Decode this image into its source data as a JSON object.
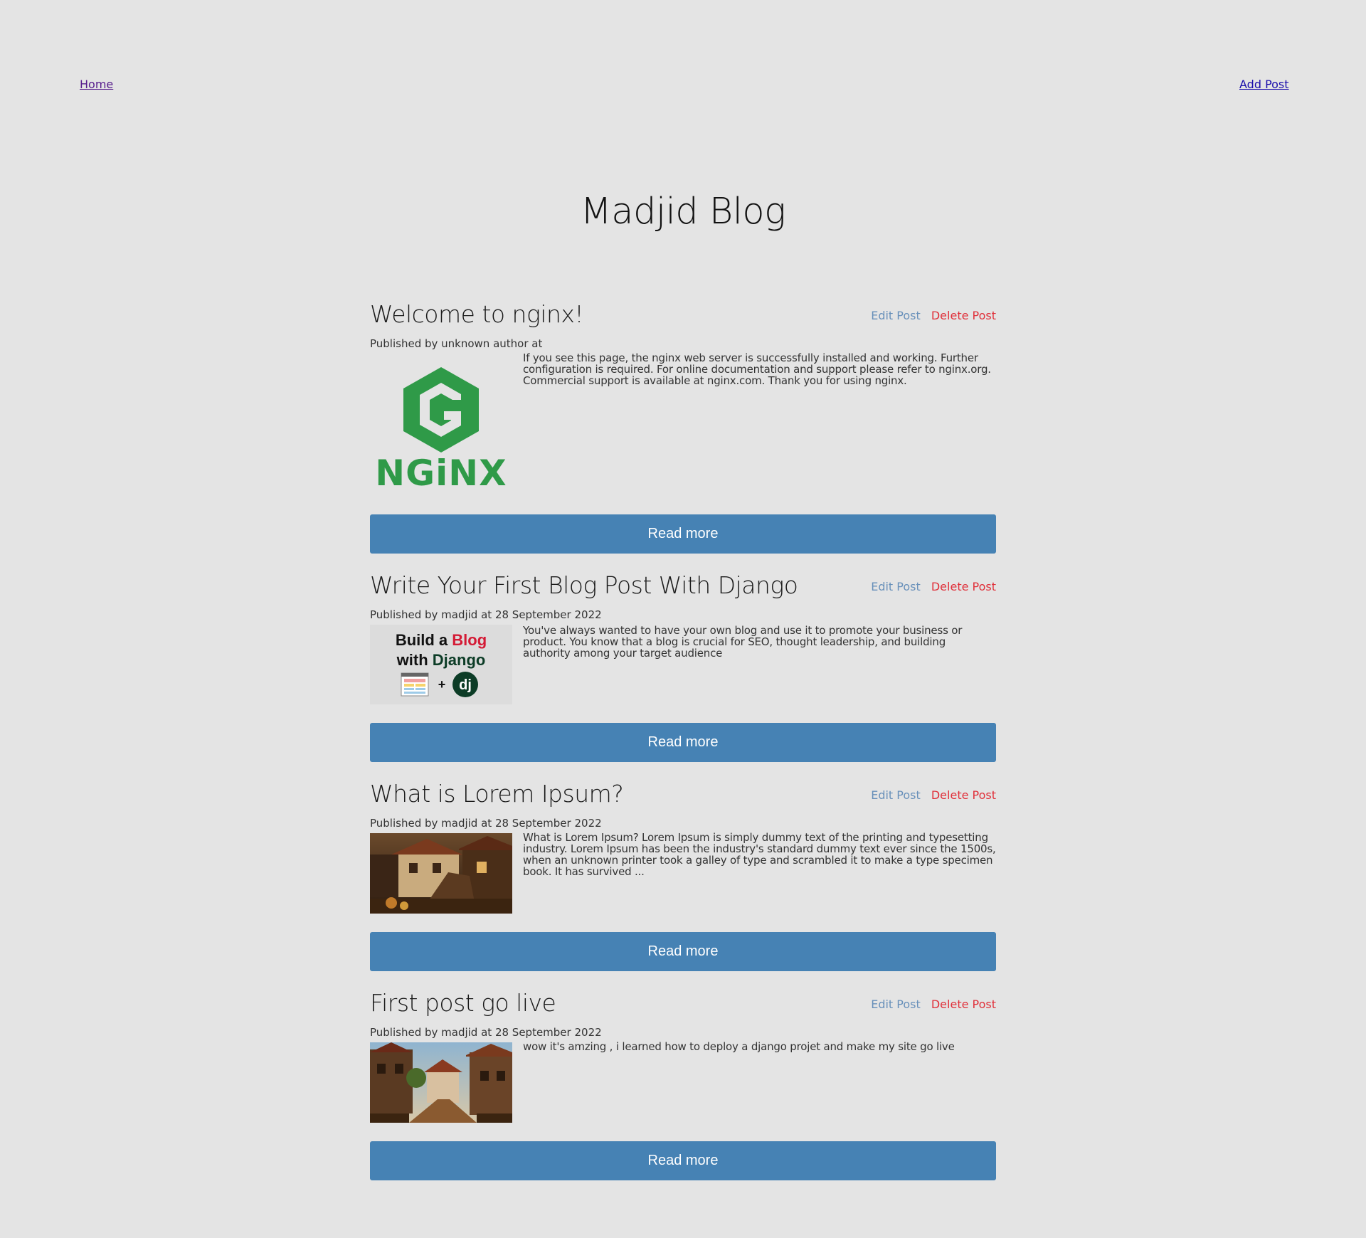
{
  "nav": {
    "home": "Home",
    "add_post": "Add Post"
  },
  "site_title": "Madjid Blog",
  "labels": {
    "edit": "Edit Post",
    "delete": "Delete Post",
    "read_more": "Read more"
  },
  "colors": {
    "background": "#e4e4e4",
    "button": "#4682b4",
    "edit_link": "#4a7cb0",
    "delete_link": "#e0303a",
    "nginx_green": "#2f9a48"
  },
  "posts": [
    {
      "title": "Welcome to nginx!",
      "meta": "Published by unknown author at",
      "excerpt": "If you see this page, the nginx web server is successfully installed and working. Further configuration is required. For online documentation and support please refer to nginx.org. Commercial support is available at nginx.com. Thank you for using nginx.",
      "image": "nginx-logo",
      "image_text": "NGiNX"
    },
    {
      "title": "Write Your First Blog Post With Django",
      "meta": "Published by madjid at 28 September 2022",
      "excerpt": "You've always wanted to have your own blog and use it to promote your business or product. You know that a blog is crucial for SEO, thought leadership, and building authority among your target audience",
      "image": "django-blog-banner",
      "banner": {
        "build_a": "Build a",
        "blog": "Blog",
        "with": "with",
        "django": "Django",
        "plus": "+",
        "dj": "dj"
      }
    },
    {
      "title": "What is Lorem Ipsum?",
      "meta": "Published by madjid at 28 September 2022",
      "excerpt": "What is Lorem Ipsum? Lorem Ipsum is simply dummy text of the printing and typesetting industry. Lorem Ipsum has been the industry's standard dummy text ever since the 1500s, when an unknown printer took a galley of type and scrambled it to make a type specimen book. It has survived ...",
      "image": "medieval-village-photo"
    },
    {
      "title": "First post go live",
      "meta": "Published by madjid at 28 September 2022",
      "excerpt": "wow it's amzing , i learned how to deploy a django projet and make my site go live",
      "image": "village-street-photo"
    }
  ]
}
